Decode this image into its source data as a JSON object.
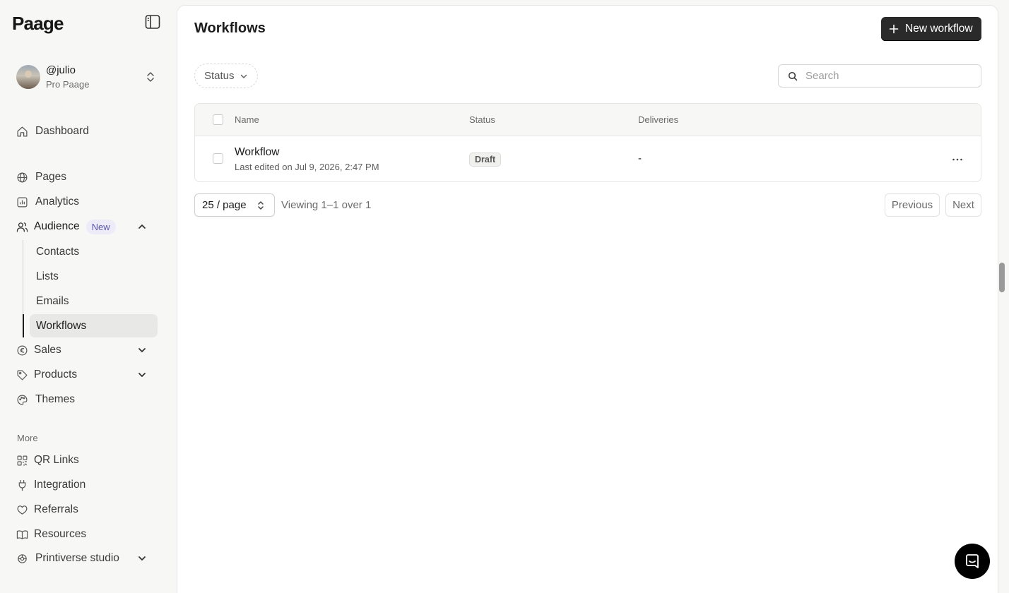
{
  "app": {
    "logo": "Paage"
  },
  "account": {
    "handle": "@julio",
    "plan": "Pro Paage"
  },
  "sidebar": {
    "dashboard": "Dashboard",
    "pages": "Pages",
    "analytics": "Analytics",
    "audience": {
      "label": "Audience",
      "badge": "New"
    },
    "audience_sub": [
      "Contacts",
      "Lists",
      "Emails",
      "Workflows"
    ],
    "sales": "Sales",
    "products": "Products",
    "themes": "Themes",
    "more_heading": "More",
    "qr_links": "QR Links",
    "integration": "Integration",
    "referrals": "Referrals",
    "resources": "Resources",
    "workspace": "Printiverse studio"
  },
  "main": {
    "title": "Workflows",
    "new_button": "New workflow",
    "filter_status": "Status",
    "search": {
      "placeholder": "Search",
      "value": ""
    },
    "table": {
      "columns": [
        "Name",
        "Status",
        "Deliveries"
      ],
      "rows": [
        {
          "name": "Workflow",
          "subtitle": "Last edited on Jul 9, 2026, 2:47 PM",
          "status": "Draft",
          "deliveries": "-"
        }
      ]
    },
    "pagination": {
      "per_page": "25 / page",
      "viewing": "Viewing 1–1 over 1",
      "previous": "Previous",
      "next": "Next"
    }
  },
  "colors": {
    "accent": "#2a2a2a",
    "badge_bg": "#ecebf7",
    "badge_text": "#5b57a6",
    "active_item_bg": "#e8e8e6"
  }
}
